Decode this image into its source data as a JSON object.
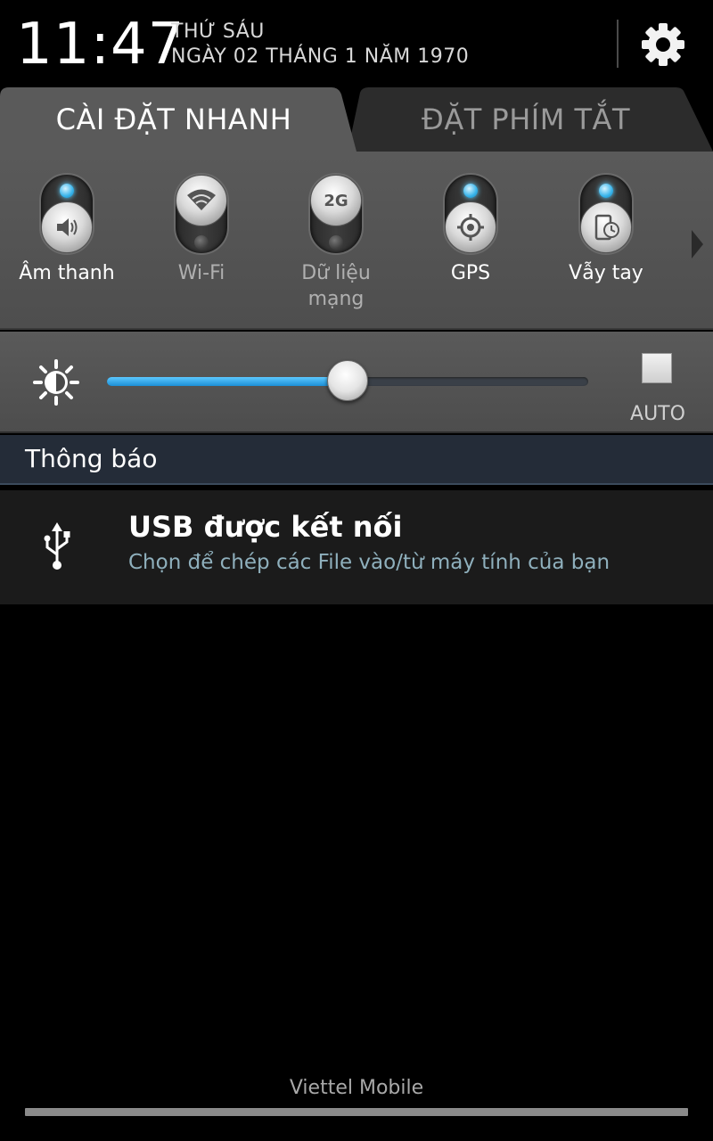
{
  "header": {
    "time": "11:47",
    "weekday": "THỨ SÁU",
    "date": "NGÀY 02 THÁNG 1 NĂM 1970",
    "settings_icon": "gear-icon"
  },
  "tabs": [
    {
      "label": "CÀI ĐẶT NHANH",
      "active": true
    },
    {
      "label": "ĐẶT PHÍM TẮT",
      "active": false
    }
  ],
  "quick_settings": {
    "toggles": [
      {
        "label": "Âm thanh",
        "icon": "speaker-icon",
        "state": "on"
      },
      {
        "label": "Wi-Fi",
        "icon": "wifi-icon",
        "state": "off"
      },
      {
        "label": "Dữ liệu mạng",
        "icon": "2g-icon",
        "icon_text": "2G",
        "state": "off"
      },
      {
        "label": "GPS",
        "icon": "gps-icon",
        "state": "on"
      },
      {
        "label": "Vẫy tay",
        "icon": "gesture-phone-icon",
        "state": "on"
      }
    ],
    "next_icon": "chevron-right-icon"
  },
  "brightness": {
    "icon": "brightness-icon",
    "level": 0.5,
    "auto_label": "AUTO",
    "auto_checked": false
  },
  "notifications": {
    "header": "Thông báo",
    "items": [
      {
        "icon": "usb-icon",
        "title": "USB được kết nối",
        "subtitle": "Chọn để chép các File vào/từ máy tính của bạn"
      }
    ]
  },
  "carrier": "Viettel Mobile",
  "colors": {
    "accent": "#33b5e5",
    "notif_header_bg": "#242c38",
    "subtitle": "#8fb0bd"
  }
}
